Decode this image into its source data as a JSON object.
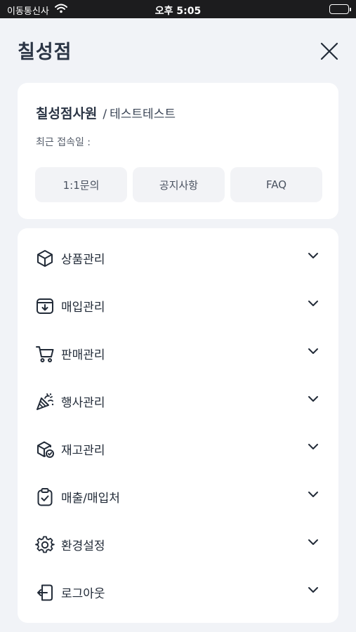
{
  "status_bar": {
    "carrier": "이동통신사",
    "time": "오후 5:05"
  },
  "header": {
    "title": "칠성점"
  },
  "profile": {
    "name": "칠성점사원",
    "separator": "/",
    "user_id": "테스트테스트",
    "last_access_label": "최근 접속일 :"
  },
  "quick_buttons": [
    {
      "label": "1:1문의"
    },
    {
      "label": "공지사항"
    },
    {
      "label": "FAQ"
    }
  ],
  "menu": [
    {
      "label": "상품관리",
      "icon": "box-icon"
    },
    {
      "label": "매입관리",
      "icon": "archive-download-icon"
    },
    {
      "label": "판매관리",
      "icon": "cart-icon"
    },
    {
      "label": "행사관리",
      "icon": "party-popper-icon"
    },
    {
      "label": "재고관리",
      "icon": "box-check-icon"
    },
    {
      "label": "매출/매입처",
      "icon": "clipboard-check-icon"
    },
    {
      "label": "환경설정",
      "icon": "gear-icon"
    },
    {
      "label": "로그아웃",
      "icon": "logout-icon"
    }
  ],
  "colors": {
    "background": "#f1f3f7",
    "card": "#ffffff",
    "text_primary": "#2b3545",
    "quick_button_bg": "#f2f3f6"
  }
}
